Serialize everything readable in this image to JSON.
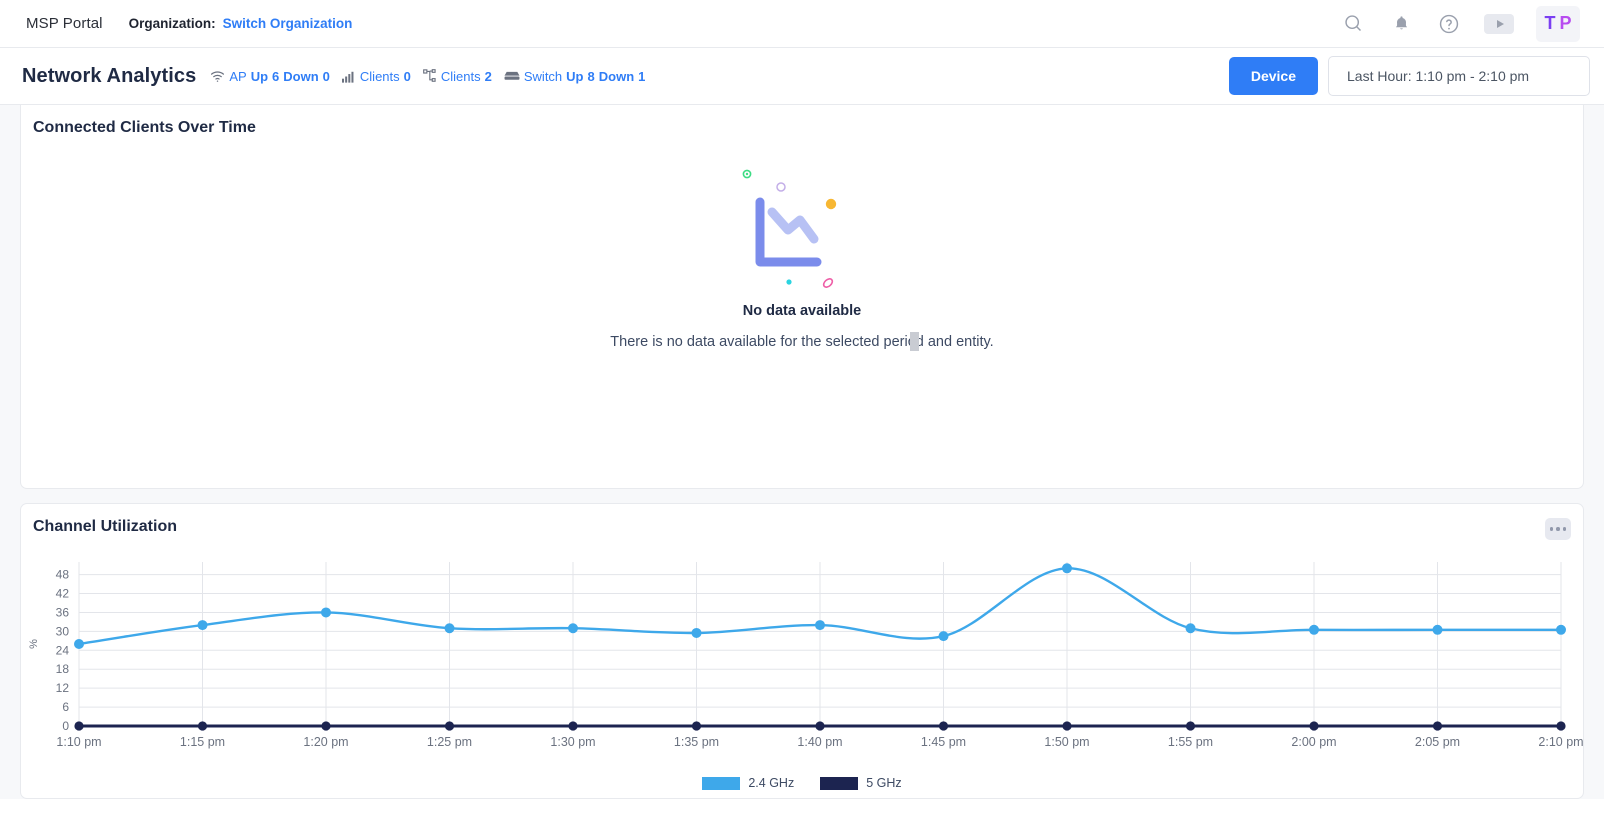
{
  "topbar": {
    "brand": "MSP Portal",
    "org_label": "Organization:",
    "org_link": "Switch Organization",
    "icons": {
      "search": "search-icon",
      "bell": "bell-icon",
      "help": "help-circle-icon",
      "video": "video-play-icon"
    },
    "avatar": {
      "initial1": "T",
      "initial2": "P"
    }
  },
  "header": {
    "title": "Network Analytics",
    "stats": [
      {
        "icon": "wifi-icon",
        "label": "AP",
        "metrics": [
          {
            "name": "Up",
            "value": "6"
          },
          {
            "name": "Down",
            "value": "0"
          }
        ]
      },
      {
        "icon": "signal-bars-icon",
        "label": "Clients",
        "metrics": [
          {
            "name": "",
            "value": "0"
          }
        ]
      },
      {
        "icon": "network-nodes-icon",
        "label": "Clients",
        "metrics": [
          {
            "name": "",
            "value": "2"
          }
        ]
      },
      {
        "icon": "switch-icon",
        "label": "Switch",
        "metrics": [
          {
            "name": "Up",
            "value": "8"
          },
          {
            "name": "Down",
            "value": "1"
          }
        ]
      }
    ],
    "device_button": "Device",
    "date_range": "Last Hour: 1:10 pm - 2:10 pm"
  },
  "clients_card": {
    "title": "Connected Clients Over Time",
    "empty_title": "No data available",
    "empty_subtitle": "There is no data available for the selected period and entity."
  },
  "chart_card": {
    "title": "Channel Utilization",
    "menu_icon": "kebab-menu-icon"
  },
  "colors": {
    "accent_blue": "#2f7df6",
    "series_24ghz": "#3ea8ea",
    "series_5ghz": "#1c2450",
    "grid": "#e3e5ea",
    "card_bg": "#ffffff",
    "page_bg": "#f7f8fa"
  },
  "chart_data": {
    "type": "line",
    "title": "Channel Utilization",
    "xlabel": "",
    "ylabel": "%",
    "ylim": [
      0,
      52
    ],
    "yticks": [
      0,
      6,
      12,
      18,
      24,
      30,
      36,
      42,
      48
    ],
    "grid": true,
    "legend_position": "bottom",
    "categories": [
      "1:10 pm",
      "1:15 pm",
      "1:20 pm",
      "1:25 pm",
      "1:30 pm",
      "1:35 pm",
      "1:40 pm",
      "1:45 pm",
      "1:50 pm",
      "1:55 pm",
      "2:00 pm",
      "2:05 pm",
      "2:10 pm"
    ],
    "series": [
      {
        "name": "2.4 GHz",
        "color": "#3ea8ea",
        "values": [
          26,
          32,
          36,
          31,
          31,
          29.5,
          32,
          28.5,
          50,
          31,
          30.5,
          30.5,
          30.5
        ]
      },
      {
        "name": "5 GHz",
        "color": "#1c2450",
        "values": [
          0,
          0,
          0,
          0,
          0,
          0,
          0,
          0,
          0,
          0,
          0,
          0,
          0
        ]
      }
    ]
  }
}
